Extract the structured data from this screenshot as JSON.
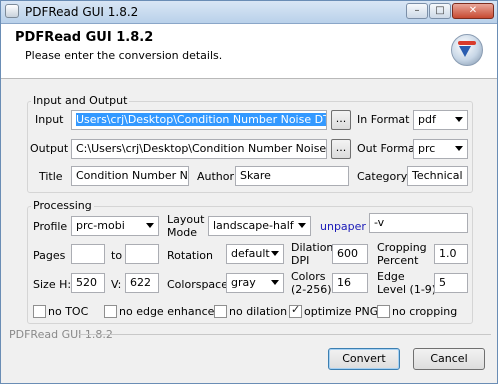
{
  "window": {
    "title": "PDFRead GUI 1.8.2",
    "min_glyph": "–",
    "max_glyph": "□",
    "close_glyph": "✕",
    "app_icon": "pdfread-app-icon",
    "logo_icon": "pdfread-logo-icon"
  },
  "header": {
    "title": "PDFRead GUI 1.8.2",
    "subtitle": "Please enter the conversion details."
  },
  "io": {
    "group_label": "Input and Output",
    "input_label": "Input",
    "input_value": "Users\\crj\\Desktop\\Condition Number Noise DTI.pdf",
    "browse_label": "...",
    "in_format_label": "In Format",
    "in_format_value": "pdf",
    "output_label": "Output",
    "output_value": "C:\\Users\\crj\\Desktop\\Condition Number Noise DTI",
    "out_format_label": "Out Format",
    "out_format_value": "prc",
    "title_label": "Title",
    "title_value": "Condition Number Noise",
    "author_label": "Author",
    "author_value": "Skare",
    "category_label": "Category",
    "category_value": "Technical"
  },
  "processing": {
    "group_label": "Processing",
    "profile_label": "Profile",
    "profile_value": "prc-mobi",
    "layout_label_1": "Layout",
    "layout_label_2": "Mode",
    "layout_value": "landscape-half",
    "unpaper_label": "unpaper",
    "unpaper_value": "-v",
    "pages_label": "Pages",
    "pages_from": "",
    "pages_to_label": "to",
    "pages_to": "",
    "rotation_label": "Rotation",
    "rotation_value": "default",
    "dilation_label_1": "Dilation",
    "dilation_label_2": "DPI",
    "dilation_value": "600",
    "cropping_label_1": "Cropping",
    "cropping_label_2": "Percent",
    "cropping_value": "1.0",
    "size_h_label": "Size H:",
    "size_h_value": "520",
    "size_v_label": "V:",
    "size_v_value": "622",
    "colorspace_label": "Colorspace",
    "colorspace_value": "gray",
    "colors_label_1": "Colors",
    "colors_label_2": "(2-256)",
    "colors_value": "16",
    "edge_label_1": "Edge",
    "edge_label_2": "Level (1-9)",
    "edge_value": "5",
    "checks": [
      {
        "label": "no TOC",
        "checked": false
      },
      {
        "label": "no edge enhance",
        "checked": false
      },
      {
        "label": "no dilation",
        "checked": false
      },
      {
        "label": "optimize PNGs",
        "checked": true
      },
      {
        "label": "no cropping",
        "checked": false
      }
    ]
  },
  "footer": {
    "version_text": "PDFRead GUI 1.8.2",
    "convert_label": "Convert",
    "cancel_label": "Cancel"
  }
}
